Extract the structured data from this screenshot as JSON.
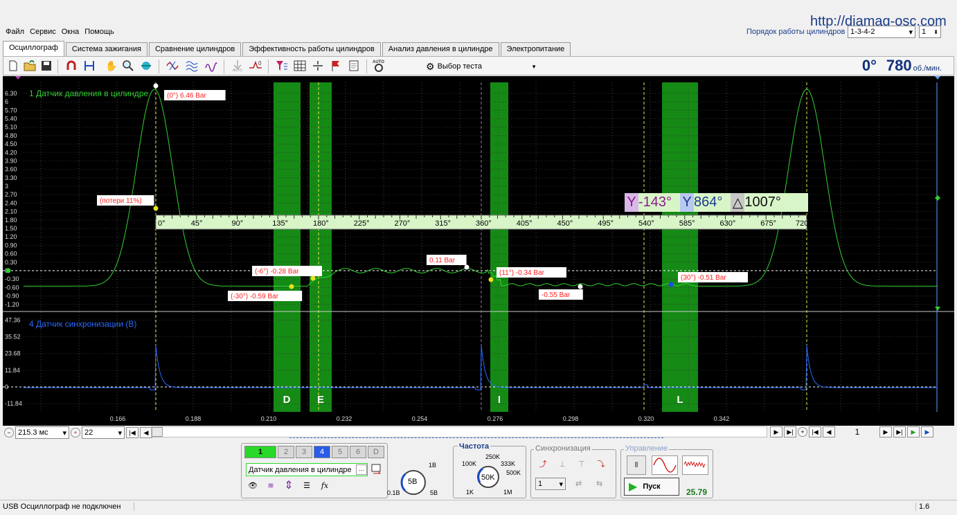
{
  "url": "http://diamag-osc.com",
  "menu": [
    "Файл",
    "Сервис",
    "Окна",
    "Помощь"
  ],
  "firing_order": {
    "label": "Порядок работы цилиндров",
    "value": "1-3-4-2",
    "cylinder": "1"
  },
  "tabs": [
    "Осциллограф",
    "Система зажигания",
    "Сравнение цилиндров",
    "Эффективность работы цилиндров",
    "Анализ давления в цилиндре",
    "Электропитание"
  ],
  "active_tab": 0,
  "toolbar": {
    "test_select": "Выбор теста",
    "auto": "AUTO"
  },
  "rpm": {
    "angle": "0°",
    "value": "780",
    "unit": "об./мин."
  },
  "channel1": {
    "title": "1 Датчик давления в цилиндре",
    "y_ticks": [
      "6.30",
      "6",
      "5.70",
      "5.40",
      "5.10",
      "4.80",
      "4.50",
      "4.20",
      "3.90",
      "3.60",
      "3.30",
      "3",
      "2.70",
      "2.40",
      "2.10",
      "1.80",
      "1.50",
      "1.20",
      "0.90",
      "0.60",
      "0.30",
      "0",
      "-0.30",
      "-0.60",
      "-0.90",
      "-1.20"
    ],
    "color": "#22c822"
  },
  "channel4": {
    "title": "4 Датчик синхронизации (В)",
    "y_ticks": [
      "47.36",
      "35.52",
      "23.68",
      "11.84",
      "0",
      "-11.84"
    ],
    "color": "#2a5cff"
  },
  "x_ticks": [
    "0.166",
    "0.188",
    "0.210",
    "0.232",
    "0.254",
    "0.276",
    "0.298",
    "0.320",
    "0.342"
  ],
  "phases": [
    "D",
    "E",
    "I",
    "L"
  ],
  "degree_ruler": [
    "0°",
    "45°",
    "90°",
    "135°",
    "180°",
    "225°",
    "270°",
    "315°",
    "360°",
    "405°",
    "450°",
    "495°",
    "540°",
    "585°",
    "630°",
    "675°",
    "720°"
  ],
  "cursors": {
    "c1": "-143°",
    "c2": "864°",
    "delta": "1007°"
  },
  "annotations": [
    {
      "text": "(0°) 6.46 Bar",
      "color": "#ff2020"
    },
    {
      "text": "(потери 11%)",
      "color": "#ff2020"
    },
    {
      "text": "(-6°) -0.28 Bar",
      "color": "#ff2020"
    },
    {
      "text": "(-30°) -0.59 Bar",
      "color": "#ff2020"
    },
    {
      "text": "0.11 Bar",
      "color": "#ff2020"
    },
    {
      "text": "(11°) -0.34 Bar",
      "color": "#ff2020"
    },
    {
      "text": "-0.55 Bar",
      "color": "#ff2020"
    },
    {
      "text": "(30°) -0.51 Bar",
      "color": "#ff2020"
    }
  ],
  "timebase": {
    "value": "215.3 мс",
    "zoom": "22"
  },
  "page": "1",
  "channels_panel": {
    "buttons": [
      "1",
      "2",
      "3",
      "4",
      "5",
      "6",
      "D"
    ],
    "sensor": "Датчик давления в цилиндре",
    "scale": "5В",
    "scale_min": "0.1В",
    "scale_top": "1В",
    "scale_max": "5В"
  },
  "frequency": {
    "title": "Частота",
    "value": "50K",
    "labels": [
      "100K",
      "250K",
      "333K",
      "500K",
      "1K",
      "1M"
    ]
  },
  "sync": {
    "title": "Синхронизация",
    "channel": "1"
  },
  "control": {
    "title": "Управление",
    "start": "Пуск",
    "fps": "25.79"
  },
  "status": {
    "text": "USB Осциллограф не подключен",
    "version": "1.6"
  }
}
